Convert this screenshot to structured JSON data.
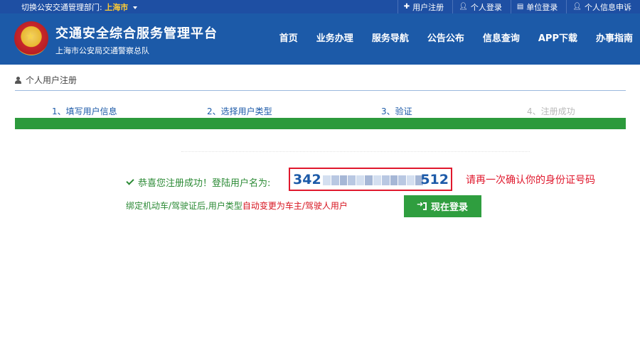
{
  "topbar": {
    "switch_label": "切换公安交通管理部门:",
    "city": "上海市",
    "links": [
      {
        "icon": "plus-icon",
        "label": "用户注册"
      },
      {
        "icon": "person-icon",
        "label": "个人登录"
      },
      {
        "icon": "document-icon",
        "label": "单位登录"
      },
      {
        "icon": "person-icon",
        "label": "个人信息申诉"
      }
    ]
  },
  "header": {
    "title": "交通安全综合服务管理平台",
    "subtitle": "上海市公安局交通警察总队",
    "nav": [
      "首页",
      "业务办理",
      "服务导航",
      "公告公布",
      "信息查询",
      "APP下载",
      "办事指南"
    ]
  },
  "breadcrumb": {
    "label": "个人用户注册"
  },
  "steps": [
    {
      "label": "1、填写用户信息",
      "state": "done"
    },
    {
      "label": "2、选择用户类型",
      "state": "done"
    },
    {
      "label": "3、验证",
      "state": "done"
    },
    {
      "label": "4、注册成功",
      "state": "pending"
    }
  ],
  "result": {
    "success_text": "恭喜您注册成功！登陆用户名为:",
    "username_prefix": "342",
    "username_suffix": "512",
    "confirm_note": "请再一次确认你的身份证号码",
    "binding_text_part1": "绑定机动车/驾驶证后,用户类型",
    "binding_text_part2": "自动变更为车主/驾驶人用户",
    "login_button": "现在登录"
  },
  "colors": {
    "header_blue": "#1c5aa8",
    "progress_green": "#2c9a3c",
    "alert_red": "#e0182d",
    "city_gold": "#ffcc33"
  }
}
